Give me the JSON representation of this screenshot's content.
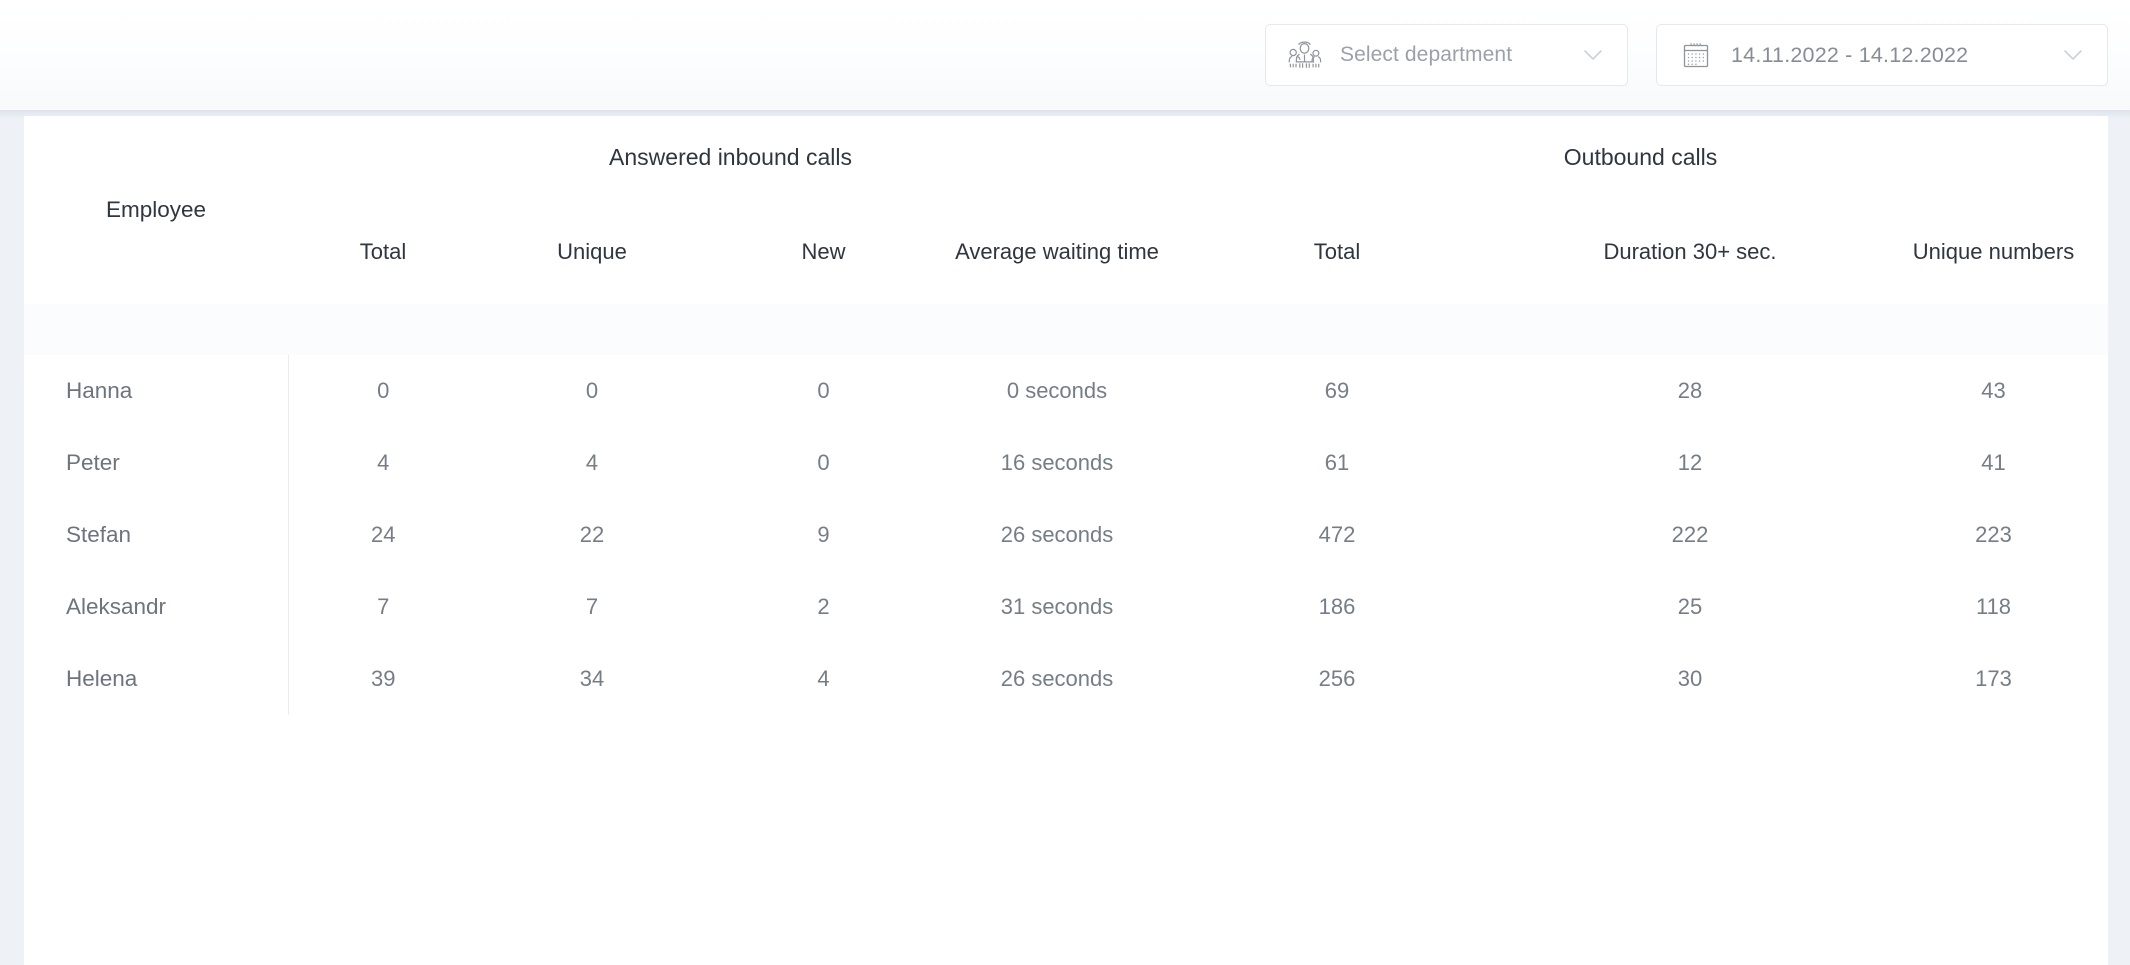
{
  "toolbar": {
    "department_selector": {
      "placeholder": "Select department",
      "icon": "people-group-icon",
      "chevron": "chevron-down-icon"
    },
    "date_range_picker": {
      "value": "14.11.2022  -  14.12.2022",
      "start_date": "14.11.2022",
      "end_date": "14.12.2022",
      "separator": "-",
      "icon": "calendar-icon",
      "chevron": "chevron-down-icon"
    }
  },
  "table": {
    "group_headers": {
      "employee": "Employee",
      "inbound": "Answered inbound calls",
      "outbound": "Outbound calls"
    },
    "columns": {
      "inbound": [
        "Total",
        "Unique",
        "New",
        "Average waiting time"
      ],
      "outbound": [
        "Total",
        "Duration 30+ sec.",
        "Unique numbers"
      ]
    },
    "rows": [
      {
        "employee": "Hanna",
        "inbound_total": "0",
        "inbound_unique": "0",
        "inbound_new": "0",
        "inbound_avg_wait": "0 seconds",
        "outbound_total": "69",
        "outbound_duration_30": "28",
        "outbound_unique_numbers": "43"
      },
      {
        "employee": "Peter",
        "inbound_total": "4",
        "inbound_unique": "4",
        "inbound_new": "0",
        "inbound_avg_wait": "16 seconds",
        "outbound_total": "61",
        "outbound_duration_30": "12",
        "outbound_unique_numbers": "41"
      },
      {
        "employee": "Stefan",
        "inbound_total": "24",
        "inbound_unique": "22",
        "inbound_new": "9",
        "inbound_avg_wait": "26 seconds",
        "outbound_total": "472",
        "outbound_duration_30": "222",
        "outbound_unique_numbers": "223"
      },
      {
        "employee": "Aleksandr",
        "inbound_total": "7",
        "inbound_unique": "7",
        "inbound_new": "2",
        "inbound_avg_wait": "31 seconds",
        "outbound_total": "186",
        "outbound_duration_30": "25",
        "outbound_unique_numbers": "118"
      },
      {
        "employee": "Helena",
        "inbound_total": "39",
        "inbound_unique": "34",
        "inbound_new": "4",
        "inbound_avg_wait": "26 seconds",
        "outbound_total": "256",
        "outbound_duration_30": "30",
        "outbound_unique_numbers": "173"
      }
    ]
  },
  "colors": {
    "header_text": "#2f3640",
    "body_text": "#767d87",
    "muted_text": "#9aa1ab",
    "border": "#e9edf1",
    "panel_bg": "#eef2f6",
    "spacer_row_bg": "#fbfcfd"
  }
}
